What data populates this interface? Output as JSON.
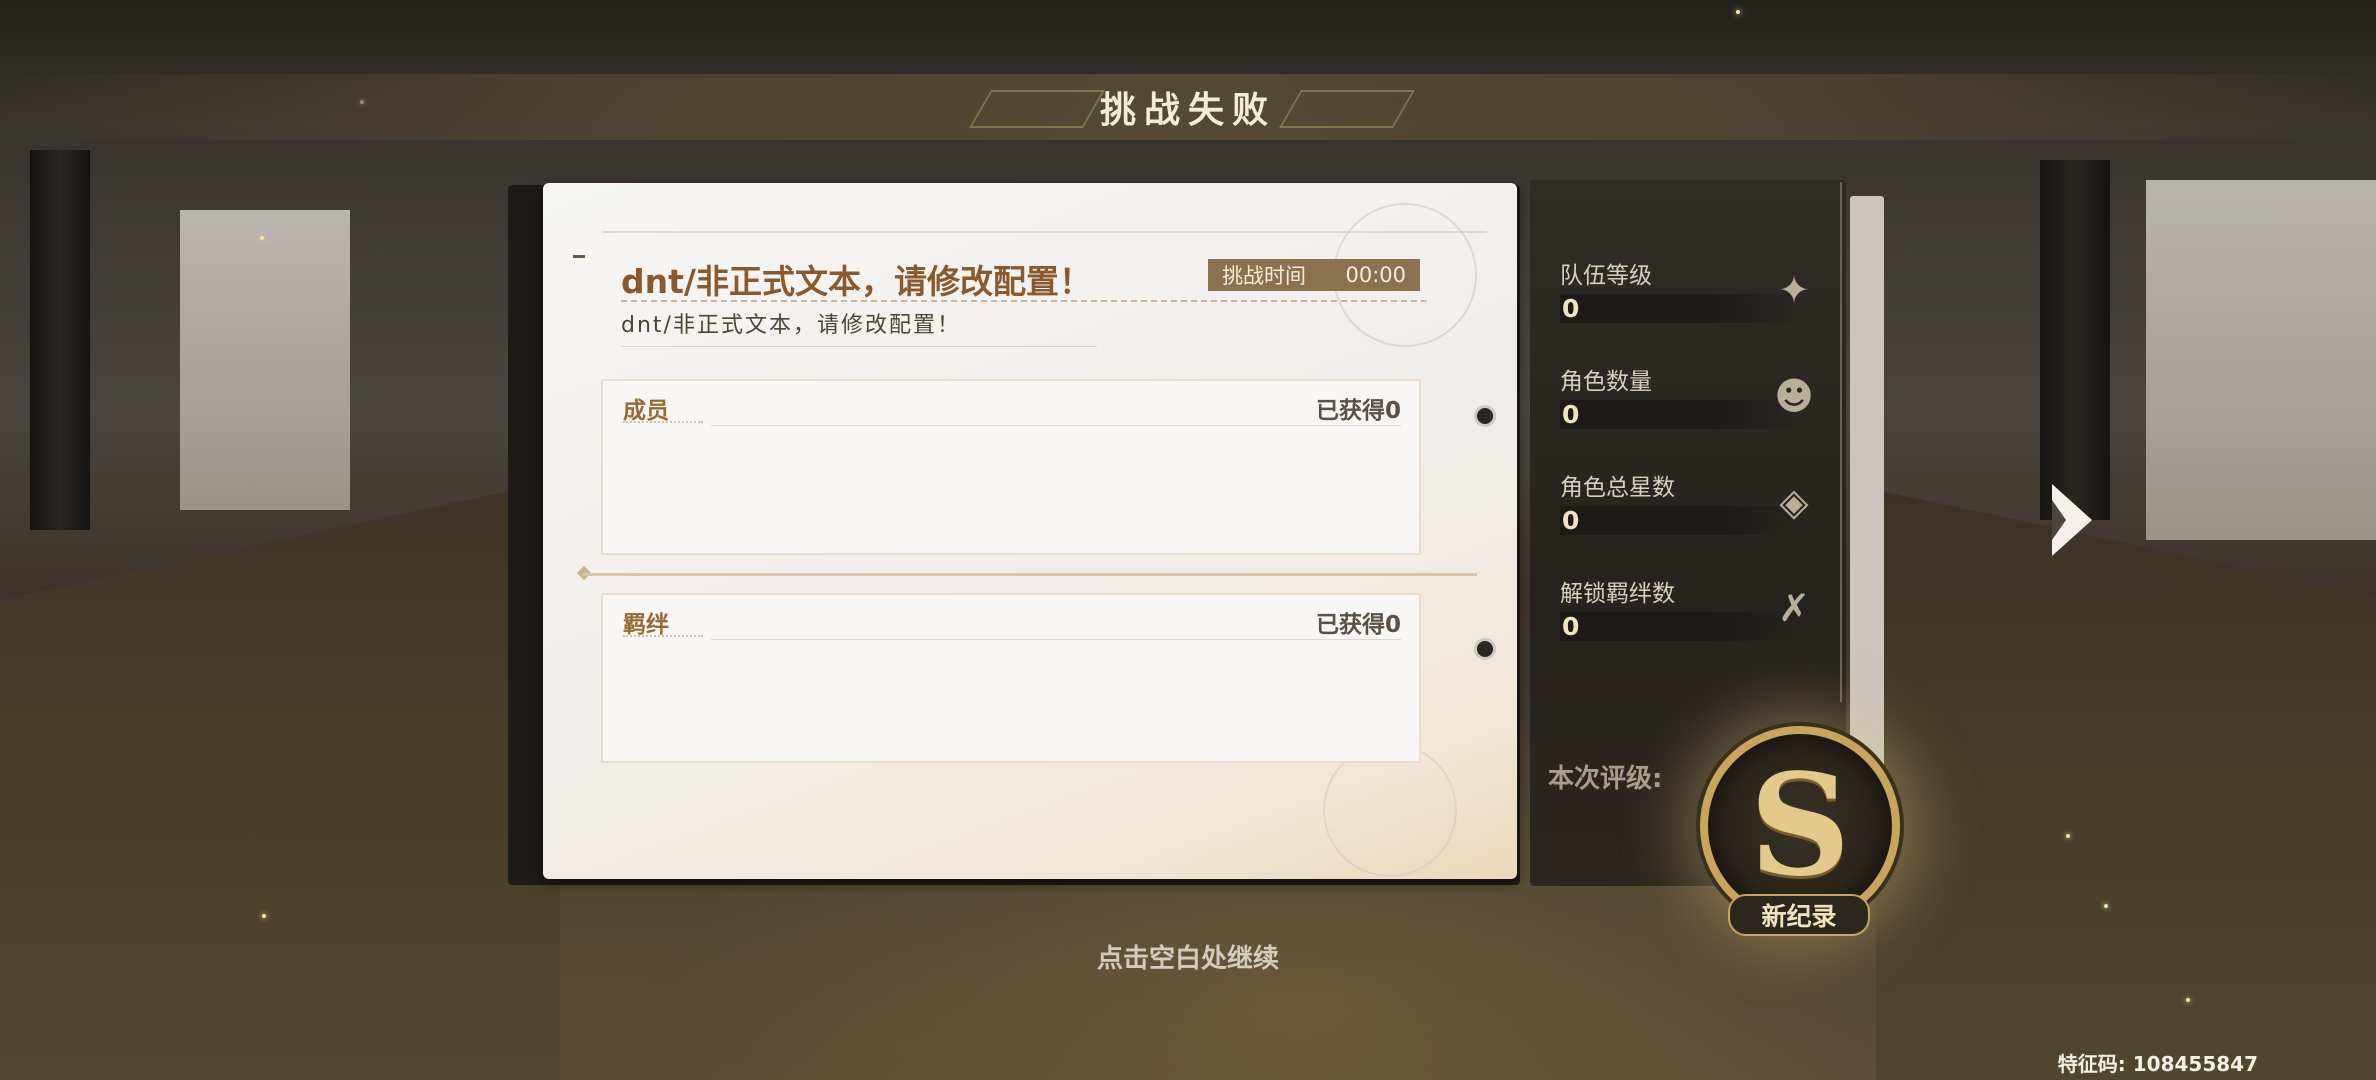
{
  "header": {
    "title": "挑战失败"
  },
  "report": {
    "title": "dnt/非正式文本，请修改配置！",
    "subtitle": "dnt/非正式文本，请修改配置！",
    "timer": {
      "label": "挑战时间",
      "value": "00:00"
    },
    "sections": [
      {
        "name": "成员",
        "count": "已获得0"
      },
      {
        "name": "羁绊",
        "count": "已获得0"
      }
    ]
  },
  "stats": [
    {
      "label": "队伍等级",
      "value": "0",
      "icon": "sparkle-star-icon"
    },
    {
      "label": "角色数量",
      "value": "0",
      "icon": "character-head-icon"
    },
    {
      "label": "角色总星数",
      "value": "0",
      "icon": "star-badge-icon"
    },
    {
      "label": "解锁羁绊数",
      "value": "0",
      "icon": "bond-link-icon"
    }
  ],
  "rating": {
    "label": "本次评级:",
    "grade": "S",
    "badge": "新纪录"
  },
  "footer": {
    "continue_hint": "点击空白处继续",
    "feature_code": "特征码: 108455847"
  },
  "colors": {
    "accent_gold": "#c9a45a",
    "title_brown": "#8a5a2e",
    "timer_bg": "#8a7150"
  }
}
